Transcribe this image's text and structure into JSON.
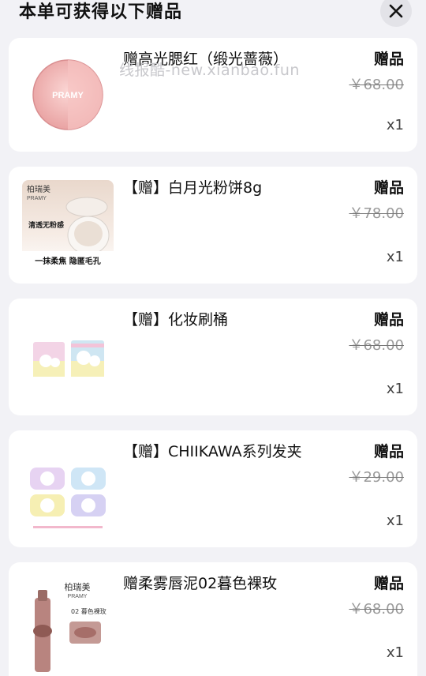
{
  "header": {
    "title": "本单可获得以下赠品"
  },
  "watermark": "线报酷-new.xianbao.fun",
  "items": [
    {
      "name": "赠高光腮红（缎光蔷薇）",
      "gift_tag": "赠品",
      "price": "￥68.00",
      "qty": "x1",
      "thumb_icon": "blush-compact-image"
    },
    {
      "name": "【赠】白月光粉饼8g",
      "gift_tag": "赠品",
      "price": "￥78.00",
      "qty": "x1",
      "thumb_icon": "powder-compact-image",
      "thumb_texts": [
        "柏瑞美",
        "PRAMY",
        "清透无粉感",
        "一抹柔焦 隐匿毛孔"
      ]
    },
    {
      "name": "【赠】化妆刷桶",
      "gift_tag": "赠品",
      "price": "￥68.00",
      "qty": "x1",
      "thumb_icon": "brush-holder-image"
    },
    {
      "name": "【赠】CHIIKAWA系列发夹",
      "gift_tag": "赠品",
      "price": "￥29.00",
      "qty": "x1",
      "thumb_icon": "hair-clip-image"
    },
    {
      "name": "赠柔雾唇泥02暮色裸玫",
      "gift_tag": "赠品",
      "price": "￥68.00",
      "qty": "x1",
      "thumb_icon": "lip-mud-image",
      "thumb_texts": [
        "柏瑞美",
        "PRAMY",
        "02 暮色裸玫"
      ]
    }
  ]
}
